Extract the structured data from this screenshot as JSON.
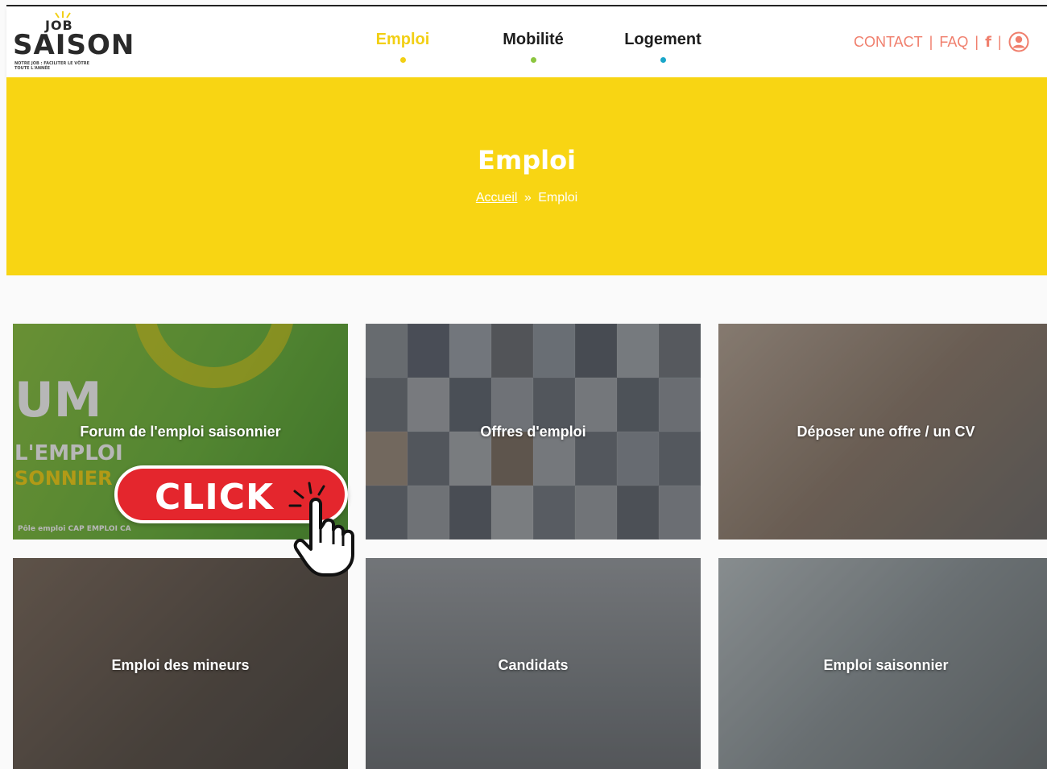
{
  "header": {
    "logo": {
      "top": "JOB",
      "main": "SAISON",
      "tagline": "NOTRE JOB : FACILITER LE VÔTRE TOUTE L'ANNÉE"
    },
    "nav": [
      {
        "label": "Emploi",
        "dot_color": "#f2cf14",
        "active": true
      },
      {
        "label": "Mobilité",
        "dot_color": "#8cc63f"
      },
      {
        "label": "Logement",
        "dot_color": "#1aa6c9"
      }
    ],
    "links": {
      "contact": "CONTACT",
      "faq": "FAQ",
      "facebook_glyph": "f",
      "separator": "|",
      "user_icon": "user-icon"
    }
  },
  "banner": {
    "title": "Emploi",
    "breadcrumb": {
      "home": "Accueil",
      "sep": "»",
      "current": "Emploi"
    }
  },
  "cards": [
    {
      "label": "Forum de l'emploi saisonnier"
    },
    {
      "label": "Offres d'emploi"
    },
    {
      "label": "Déposer une offre / un CV"
    },
    {
      "label": "Emploi des mineurs"
    },
    {
      "label": "Candidats"
    },
    {
      "label": "Emploi saisonnier"
    }
  ],
  "forum_image": {
    "line1": "UM",
    "line2": "L'EMPLOI",
    "line3": "SONNIER",
    "partners": "Pôle emploi   CAP EMPLOI   CA"
  },
  "click_sticker": {
    "text": "CLICK"
  },
  "colors": {
    "accent_yellow": "#f8d513",
    "link_coral": "#f07f6d",
    "click_red": "#e4262d"
  }
}
